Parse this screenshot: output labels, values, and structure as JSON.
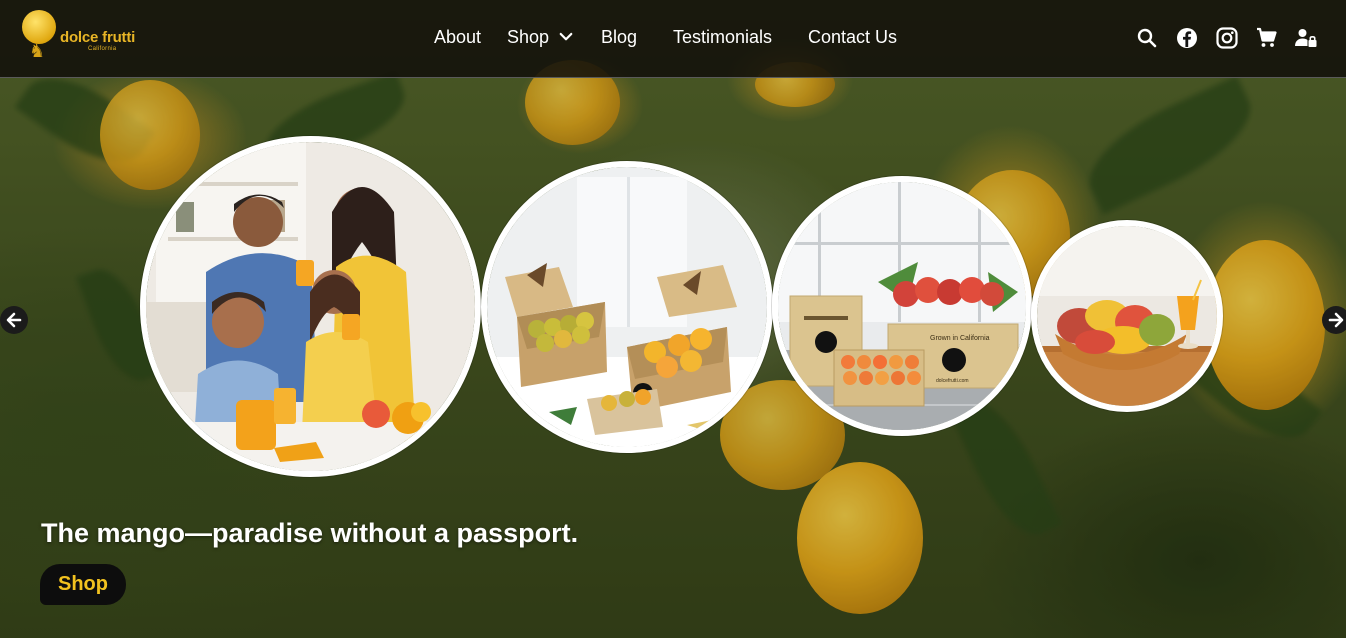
{
  "brand": {
    "name": "dolce frutti",
    "sub": "California"
  },
  "nav": {
    "items": [
      {
        "label": "About"
      },
      {
        "label": "Shop"
      },
      {
        "label": "Blog"
      },
      {
        "label": "Testimonials"
      },
      {
        "label": "Contact Us"
      }
    ]
  },
  "header_icons": [
    "search-icon",
    "facebook-icon",
    "instagram-icon",
    "cart-icon",
    "account-lock-icon"
  ],
  "carousel": {
    "slides": [
      {
        "name": "family-enjoying-mango-juice"
      },
      {
        "name": "mango-gift-boxes"
      },
      {
        "name": "grown-in-california-boxes",
        "box_label": "Grown in California",
        "box_url": "dolcefrutti.com"
      },
      {
        "name": "mango-bowl-with-juice"
      }
    ]
  },
  "hero": {
    "tagline": "The mango—paradise without a passport.",
    "cta_label": "Shop"
  },
  "colors": {
    "brand_gold": "#e8b526",
    "cta_text": "#f2c21f",
    "cta_bg": "#0d0d0d",
    "header_bg": "#12100a"
  }
}
